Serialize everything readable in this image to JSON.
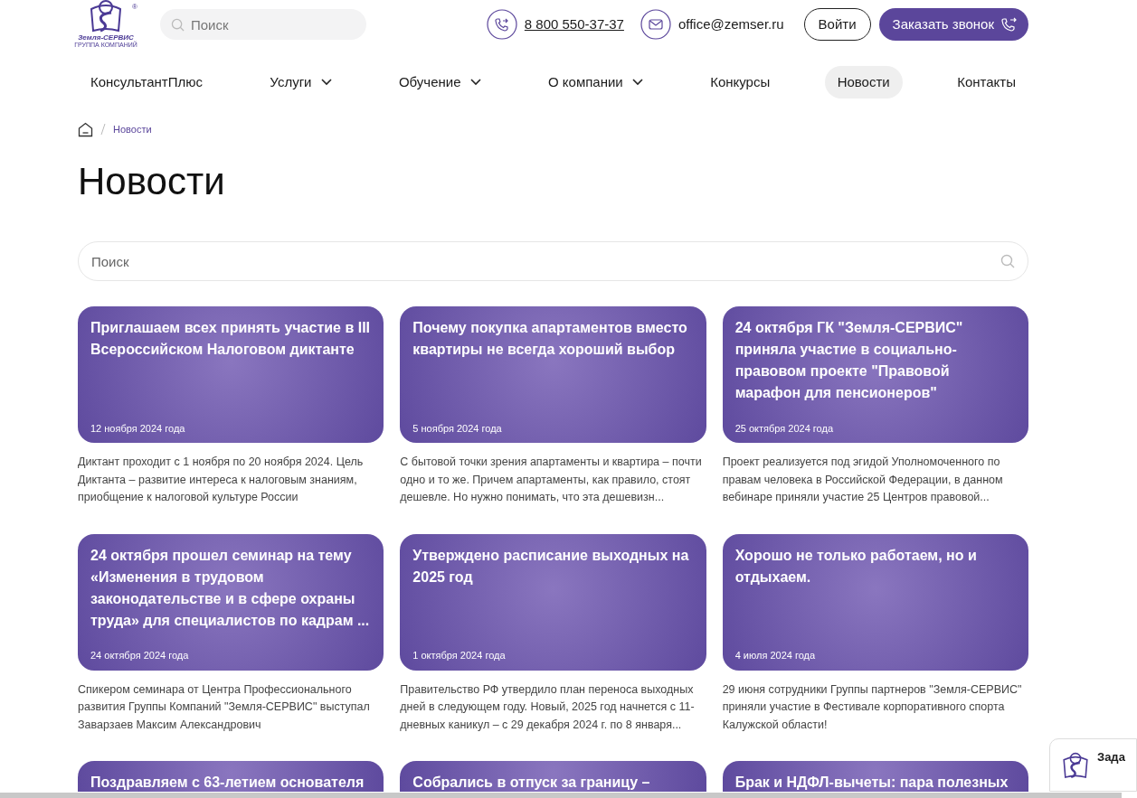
{
  "header": {
    "logo": {
      "name": "Земля-СЕРВИС",
      "subtitle": "ГРУППА КОМПАНИЙ",
      "mark": "®"
    },
    "search": {
      "placeholder": "Поиск"
    },
    "phone": "8 800 550-37-37",
    "email": "office@zemser.ru",
    "login_button": "Войти",
    "callback_button": "Заказать звонок"
  },
  "nav": [
    {
      "label": "КонсультантПлюс",
      "dropdown": false,
      "selected": false
    },
    {
      "label": "Услуги",
      "dropdown": true,
      "selected": false
    },
    {
      "label": "Обучение",
      "dropdown": true,
      "selected": false
    },
    {
      "label": "О компании",
      "dropdown": true,
      "selected": false
    },
    {
      "label": "Конкурсы",
      "dropdown": false,
      "selected": false
    },
    {
      "label": "Новости",
      "dropdown": false,
      "selected": true
    },
    {
      "label": "Контакты",
      "dropdown": false,
      "selected": false
    }
  ],
  "breadcrumbs": [
    "Новости"
  ],
  "page_title": "Новости",
  "news_search": {
    "placeholder": "Поиск"
  },
  "news": [
    {
      "title": "Приглашаем всех принять участие в III Всероссийском Налоговом диктанте",
      "date": "12 ноября 2024 года",
      "summary": "Диктант проходит с 1 ноября по 20 ноября 2024. Цель Диктанта – развитие интереса к налоговым знаниям, приобщение к налоговой культуре России"
    },
    {
      "title": "Почему покупка апартаментов вместо квартиры не всегда хороший выбор",
      "date": "5 ноября 2024 года",
      "summary": "С бытовой точки зрения апартаменты и квартира – почти одно и то же. Причем апартаменты, как правило, стоят дешевле. Но нужно понимать, что эта дешевизн..."
    },
    {
      "title": "24 октября ГК \"Земля-СЕРВИС\" приняла участие в социально-правовом проекте \"Правовой марафон для пенсионеров\"",
      "date": "25 октября 2024 года",
      "summary": "Проект реализуется под эгидой Уполномоченного по правам человека в Российской Федерации, в данном вебинаре приняли участие 25 Центров правовой..."
    },
    {
      "title": "24 октября прошел семинар на тему «Изменения в трудовом законодательстве и в сфере охраны труда» для специалистов по кадрам ...",
      "date": "24 октября 2024 года",
      "summary": "Спикером семинара от Центра Профессионального развития Группы Компаний \"Земля-СЕРВИС\" выступал Заварзаев Максим Александрович"
    },
    {
      "title": "Утверждено расписание выходных на 2025 год",
      "date": "1 октября 2024 года",
      "summary": "Правительство РФ утвердило план переноса выходных дней в следующем году. Новый, 2025 год начнется с 11-дневных каникул – с 29 декабря 2024 г. по 8 января..."
    },
    {
      "title": "Хорошо не только работаем, но и отдыхаем.",
      "date": "4 июля 2024 года",
      "summary": "29 июня сотрудники Группы партнеров \"Земля-СЕРВИС\" приняли участие в Фестивале корпоративного спорта Калужской области!"
    },
    {
      "title": "Поздравляем с 63-летием основателя"
    },
    {
      "title": "Собрались в отпуск за границу –"
    },
    {
      "title": "Брак и НДФЛ-вычеты: пара полезных"
    }
  ],
  "chat_widget": {
    "label": "Зада"
  }
}
